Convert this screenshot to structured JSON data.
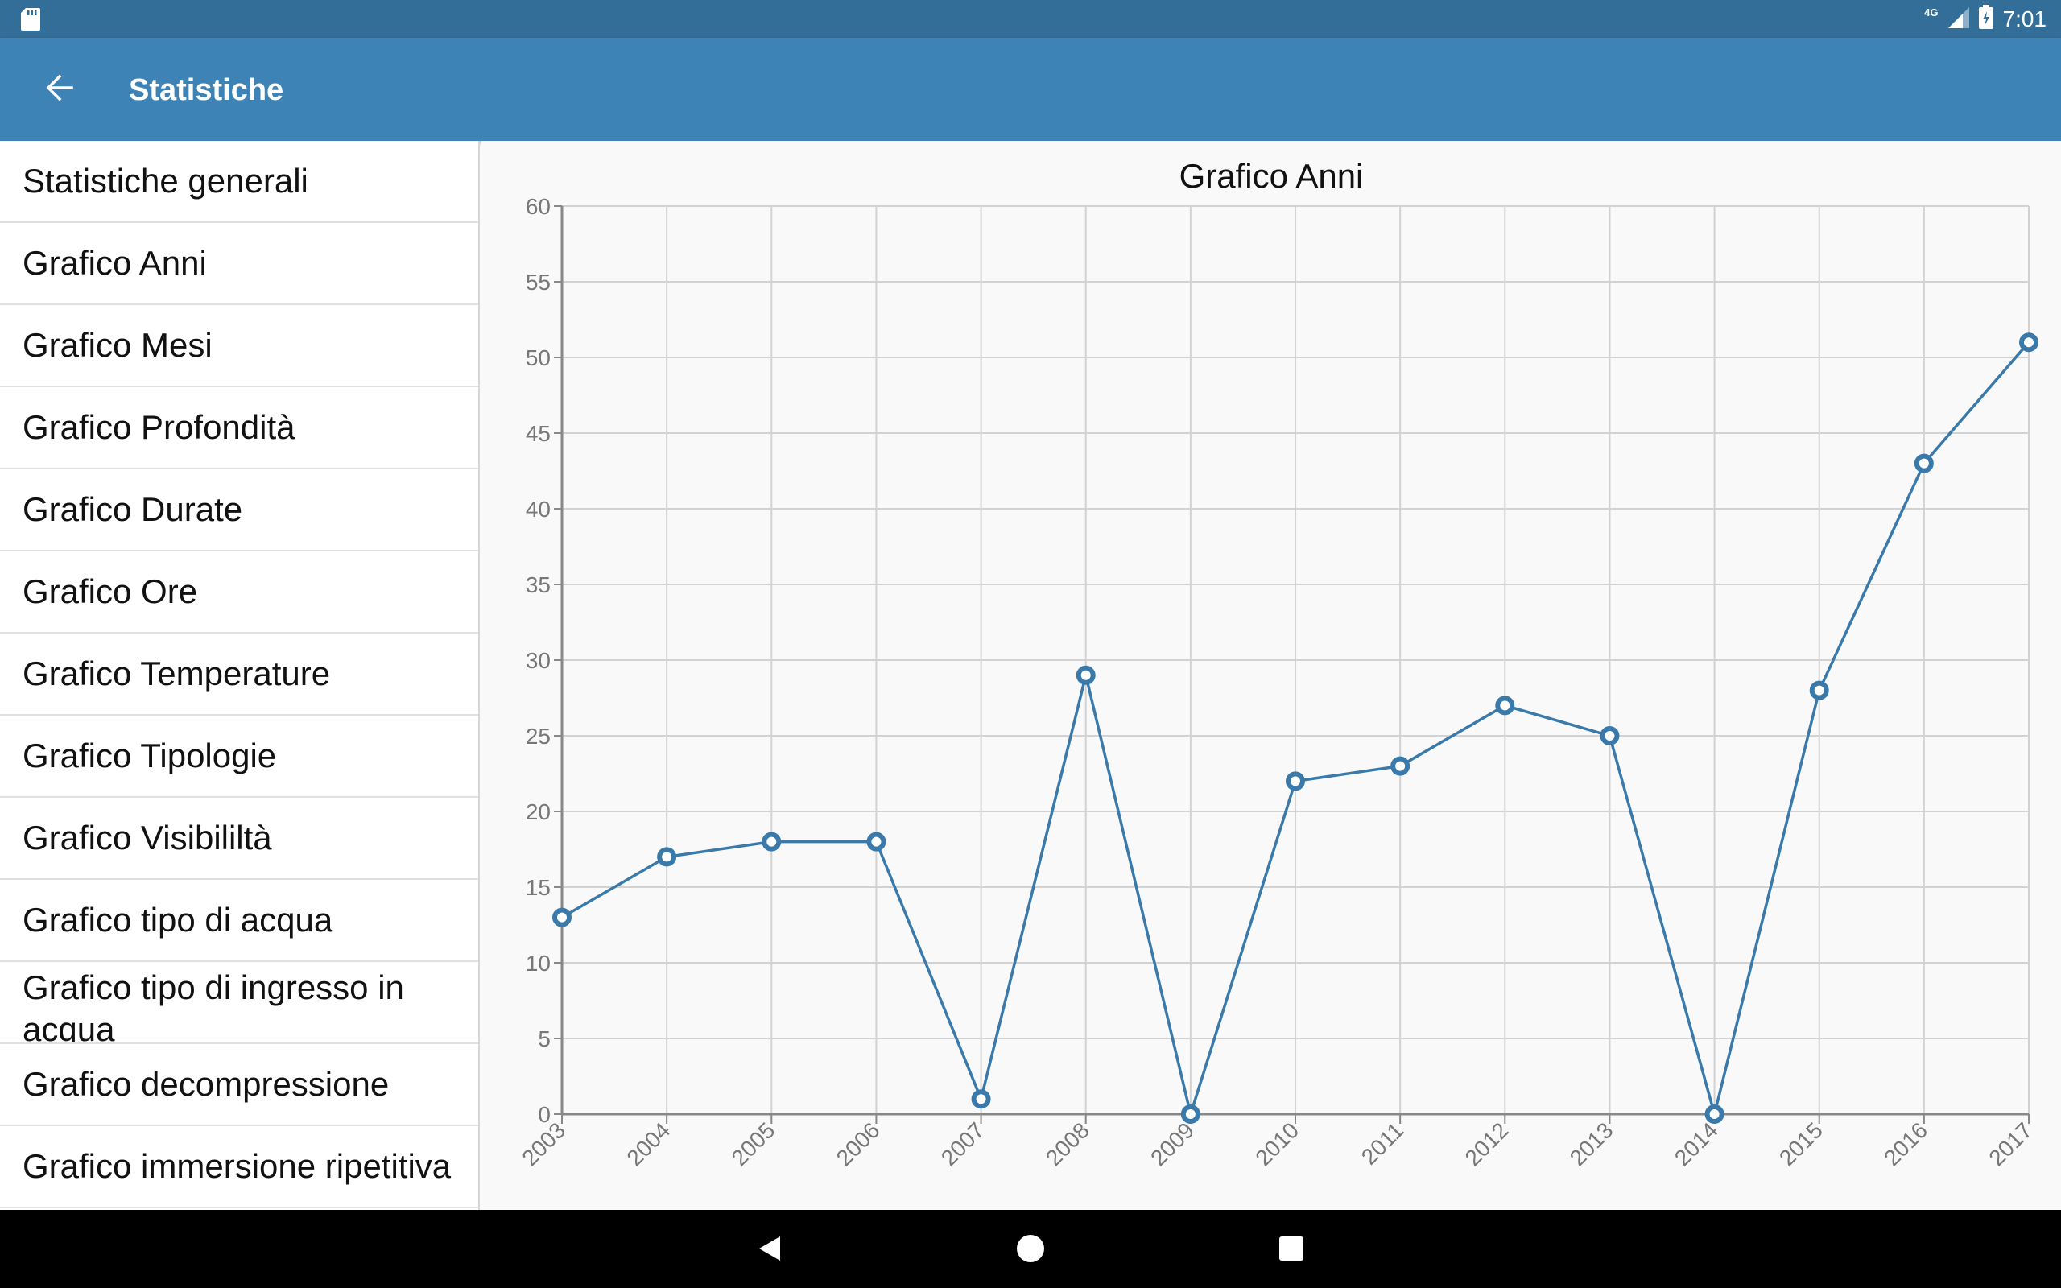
{
  "status_bar": {
    "time": "7:01",
    "network": "4G",
    "icons": [
      "sd-card-icon",
      "signal-icon",
      "battery-charging-icon"
    ]
  },
  "app_bar": {
    "title": "Statistiche",
    "back_icon": "arrow-left-icon"
  },
  "sidebar": {
    "items": [
      {
        "label": "Statistiche generali"
      },
      {
        "label": "Grafico Anni"
      },
      {
        "label": "Grafico Mesi"
      },
      {
        "label": "Grafico Profondità"
      },
      {
        "label": "Grafico Durate"
      },
      {
        "label": "Grafico Ore"
      },
      {
        "label": "Grafico Temperature"
      },
      {
        "label": "Grafico Tipologie"
      },
      {
        "label": "Grafico Visibililtà"
      },
      {
        "label": "Grafico tipo di acqua"
      },
      {
        "label": "Grafico tipo di ingresso in acqua"
      },
      {
        "label": "Grafico decompressione"
      },
      {
        "label": "Grafico immersione ripetitiva"
      }
    ]
  },
  "chart_data": {
    "type": "line",
    "title": "Grafico Anni",
    "xlabel": "",
    "ylabel": "",
    "x": [
      "2003",
      "2004",
      "2005",
      "2006",
      "2007",
      "2008",
      "2009",
      "2010",
      "2011",
      "2012",
      "2013",
      "2014",
      "2015",
      "2016",
      "2017"
    ],
    "series": [
      {
        "values": [
          13,
          17,
          18,
          18,
          1,
          29,
          0,
          22,
          23,
          27,
          25,
          0,
          28,
          43,
          51
        ]
      }
    ],
    "ylim": [
      0,
      60
    ],
    "yticks": [
      "0",
      "5",
      "10",
      "15",
      "20",
      "25",
      "30",
      "35",
      "40",
      "45",
      "50",
      "55",
      "60"
    ],
    "grid": true,
    "legend": "none",
    "line_color": "#3a7aaa",
    "marker": "hollow-circle"
  },
  "nav_bar": {
    "icons": [
      "back-triangle-icon",
      "home-circle-icon",
      "recents-square-icon"
    ]
  },
  "colors": {
    "status_bar": "#336e98",
    "app_bar": "#3e83b5",
    "accent": "#3a7aaa"
  }
}
